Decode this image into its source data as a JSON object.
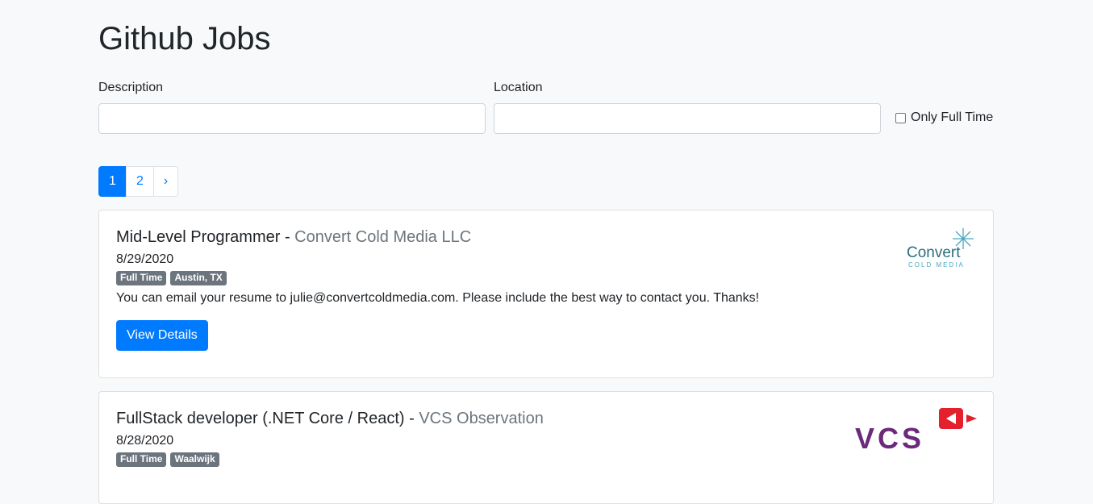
{
  "page": {
    "title": "Github Jobs"
  },
  "search": {
    "description_label": "Description",
    "description_value": "",
    "location_label": "Location",
    "location_value": "",
    "fulltime_label": "Only Full Time"
  },
  "pagination": {
    "pages": [
      "1",
      "2"
    ],
    "next": "›",
    "active": "1"
  },
  "jobs": [
    {
      "title": "Mid-Level Programmer",
      "separator": " - ",
      "company": "Convert Cold Media LLC",
      "date": "8/29/2020",
      "type": "Full Time",
      "location": "Austin, TX",
      "description": "You can email your resume to julie@convertcoldmedia.com. Please include the best way to contact you. Thanks!",
      "button": "View Details",
      "logo": {
        "word": "Convert",
        "subword": "COLD MEDIA",
        "icon": "snowflake-icon"
      }
    },
    {
      "title": "FullStack developer (.NET Core / React)",
      "separator": " - ",
      "company": "VCS Observation",
      "date": "8/28/2020",
      "type": "Full Time",
      "location": "Waalwijk",
      "logo": {
        "word": "VCS",
        "icon": "video-play-icon"
      }
    }
  ],
  "colors": {
    "primary": "#007bff",
    "badge": "#6c757d",
    "vcs_purple": "#6b2a7a",
    "vcs_red": "#e4202c"
  }
}
